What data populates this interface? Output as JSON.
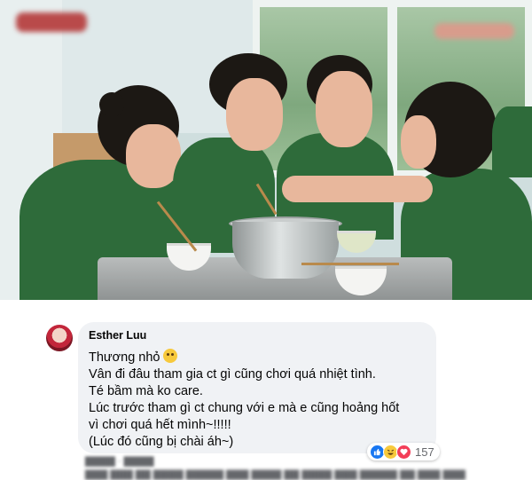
{
  "comment": {
    "author": "Esther Luu",
    "lines": [
      "Thương nhỏ",
      "Vân đi đâu tham gia ct gì cũng chơi quá nhiệt tình.",
      "Té bầm mà ko care.",
      "Lúc trước tham gì ct chung với e mà e cũng hoảng hốt",
      "vì chơi quá hết mình~!!!!!",
      "(Lúc đó cũng bị chài áh~)"
    ],
    "emoji": "crying-face-icon",
    "reaction_count": "157",
    "reactions": [
      "like-icon",
      "haha-icon",
      "love-icon"
    ]
  },
  "colors": {
    "bubble_bg": "#f0f2f5",
    "like": "#1877f2",
    "love": "#f33e58",
    "haha": "#f7c93c",
    "uniform_green": "#2e6b3a"
  }
}
